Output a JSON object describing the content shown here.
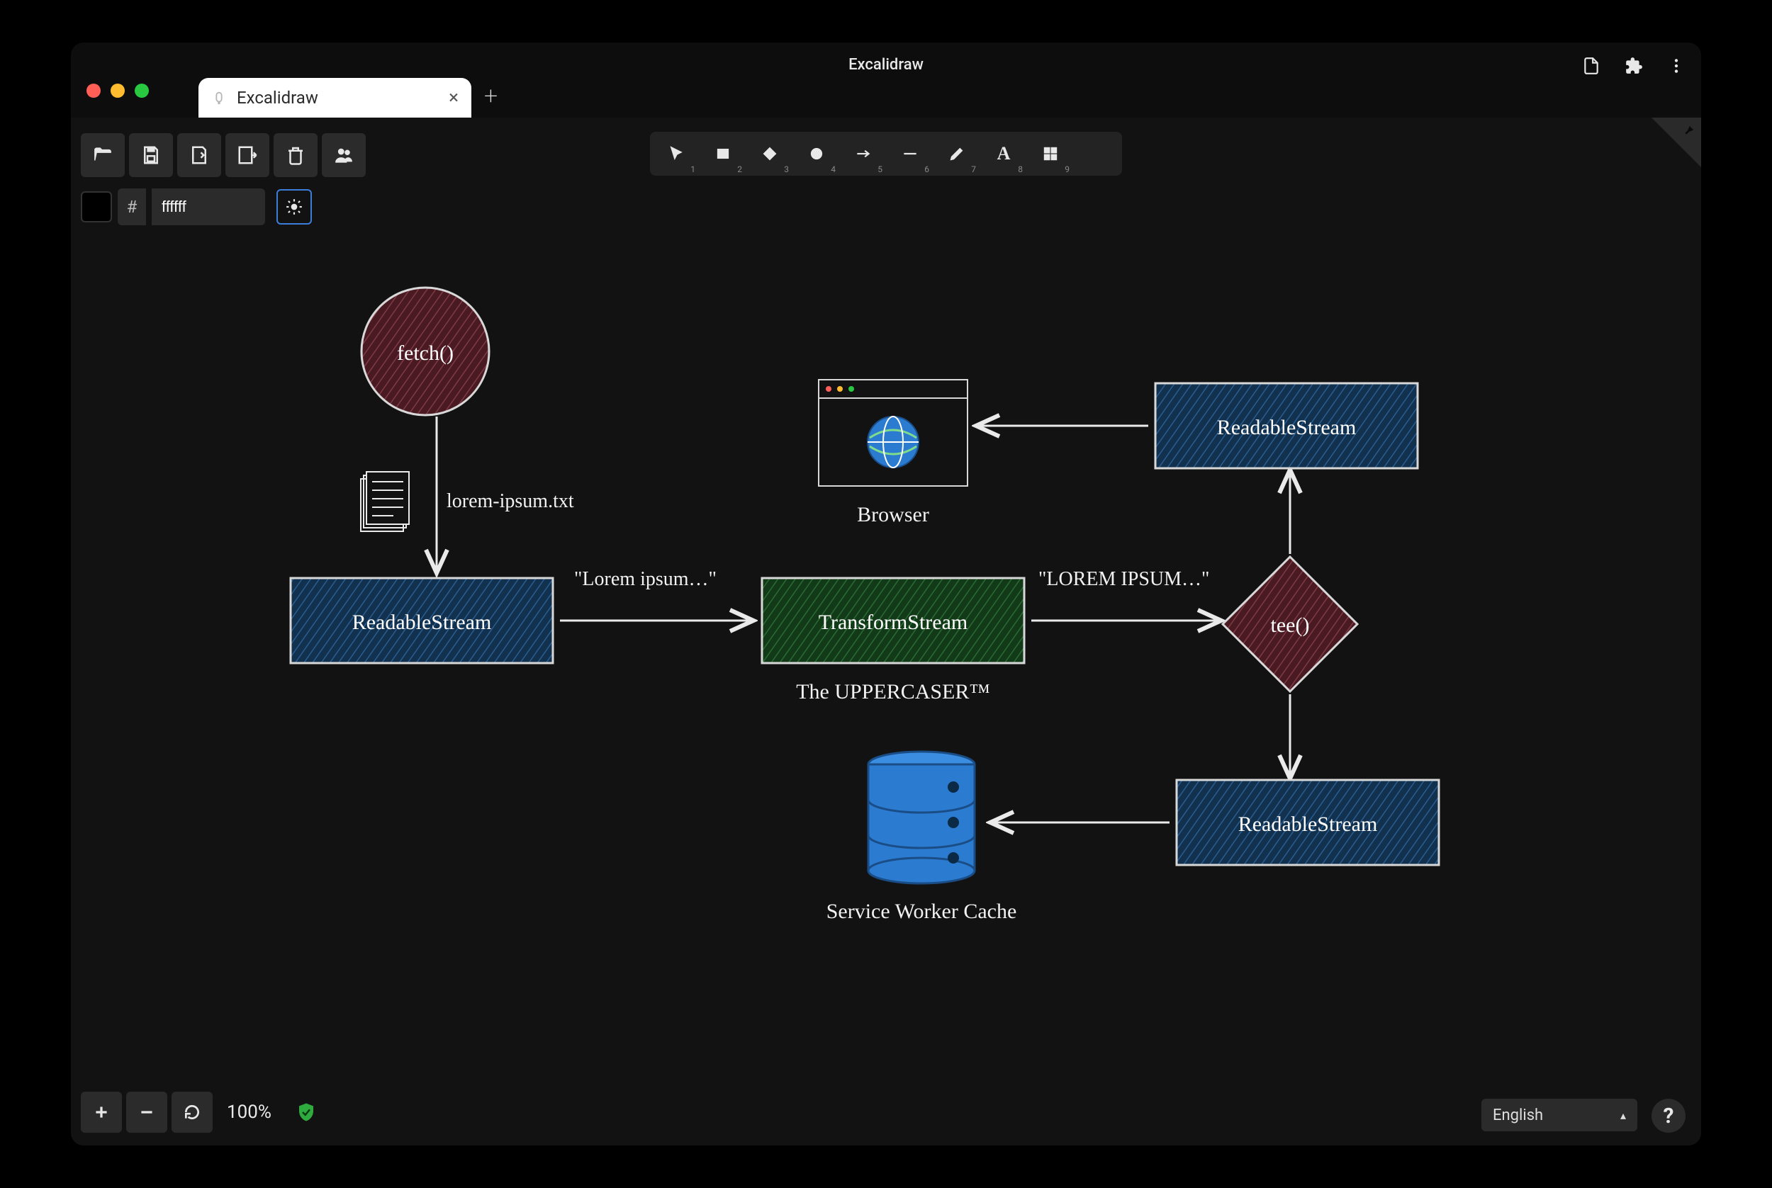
{
  "window": {
    "title": "Excalidraw",
    "tab_title": "Excalidraw"
  },
  "color_input": {
    "value": "ffffff",
    "hash": "#"
  },
  "tools": [
    {
      "id": "select",
      "num": "1"
    },
    {
      "id": "rect",
      "num": "2"
    },
    {
      "id": "diamond",
      "num": "3"
    },
    {
      "id": "ellipse",
      "num": "4"
    },
    {
      "id": "arrow",
      "num": "5"
    },
    {
      "id": "line",
      "num": "6"
    },
    {
      "id": "draw",
      "num": "7"
    },
    {
      "id": "text",
      "num": "8"
    },
    {
      "id": "library",
      "num": "9"
    }
  ],
  "zoom": "100%",
  "language": "English",
  "diagram": {
    "nodes": {
      "fetch": {
        "label": "fetch()",
        "shape": "circle",
        "fill": "#5b1f2a",
        "stroke": "#c8c8c8"
      },
      "file": {
        "label": "lorem-ipsum.txt",
        "shape": "doc",
        "fill": "none",
        "stroke": "#eaeaea"
      },
      "rs1": {
        "label": "ReadableStream",
        "shape": "rect",
        "fill": "#153a5c",
        "stroke": "#d8d8d8"
      },
      "transform": {
        "label": "TransformStream",
        "shape": "rect",
        "fill": "#14421a",
        "stroke": "#d8d8d8",
        "caption": "The UPPERCASER™"
      },
      "tee": {
        "label": "tee()",
        "shape": "diamond",
        "fill": "#5b1f2a",
        "stroke": "#d8d8d8"
      },
      "rs_top": {
        "label": "ReadableStream",
        "shape": "rect",
        "fill": "#153a5c",
        "stroke": "#d8d8d8"
      },
      "rs_bot": {
        "label": "ReadableStream",
        "shape": "rect",
        "fill": "#153a5c",
        "stroke": "#d8d8d8"
      },
      "browser": {
        "label": "Browser",
        "shape": "window",
        "fill": "none",
        "stroke": "#d8d8d8"
      },
      "cache": {
        "label": "Service Worker Cache",
        "shape": "cylinder",
        "fill": "#2b7bd1",
        "stroke": "#1a4d86"
      }
    },
    "edges": [
      {
        "from": "fetch",
        "to": "rs1",
        "label": ""
      },
      {
        "from": "rs1",
        "to": "transform",
        "label": "\"Lorem ipsum…\""
      },
      {
        "from": "transform",
        "to": "tee",
        "label": "\"LOREM IPSUM…\""
      },
      {
        "from": "tee",
        "to": "rs_top",
        "label": ""
      },
      {
        "from": "tee",
        "to": "rs_bot",
        "label": ""
      },
      {
        "from": "rs_top",
        "to": "browser",
        "label": ""
      },
      {
        "from": "rs_bot",
        "to": "cache",
        "label": ""
      }
    ]
  }
}
